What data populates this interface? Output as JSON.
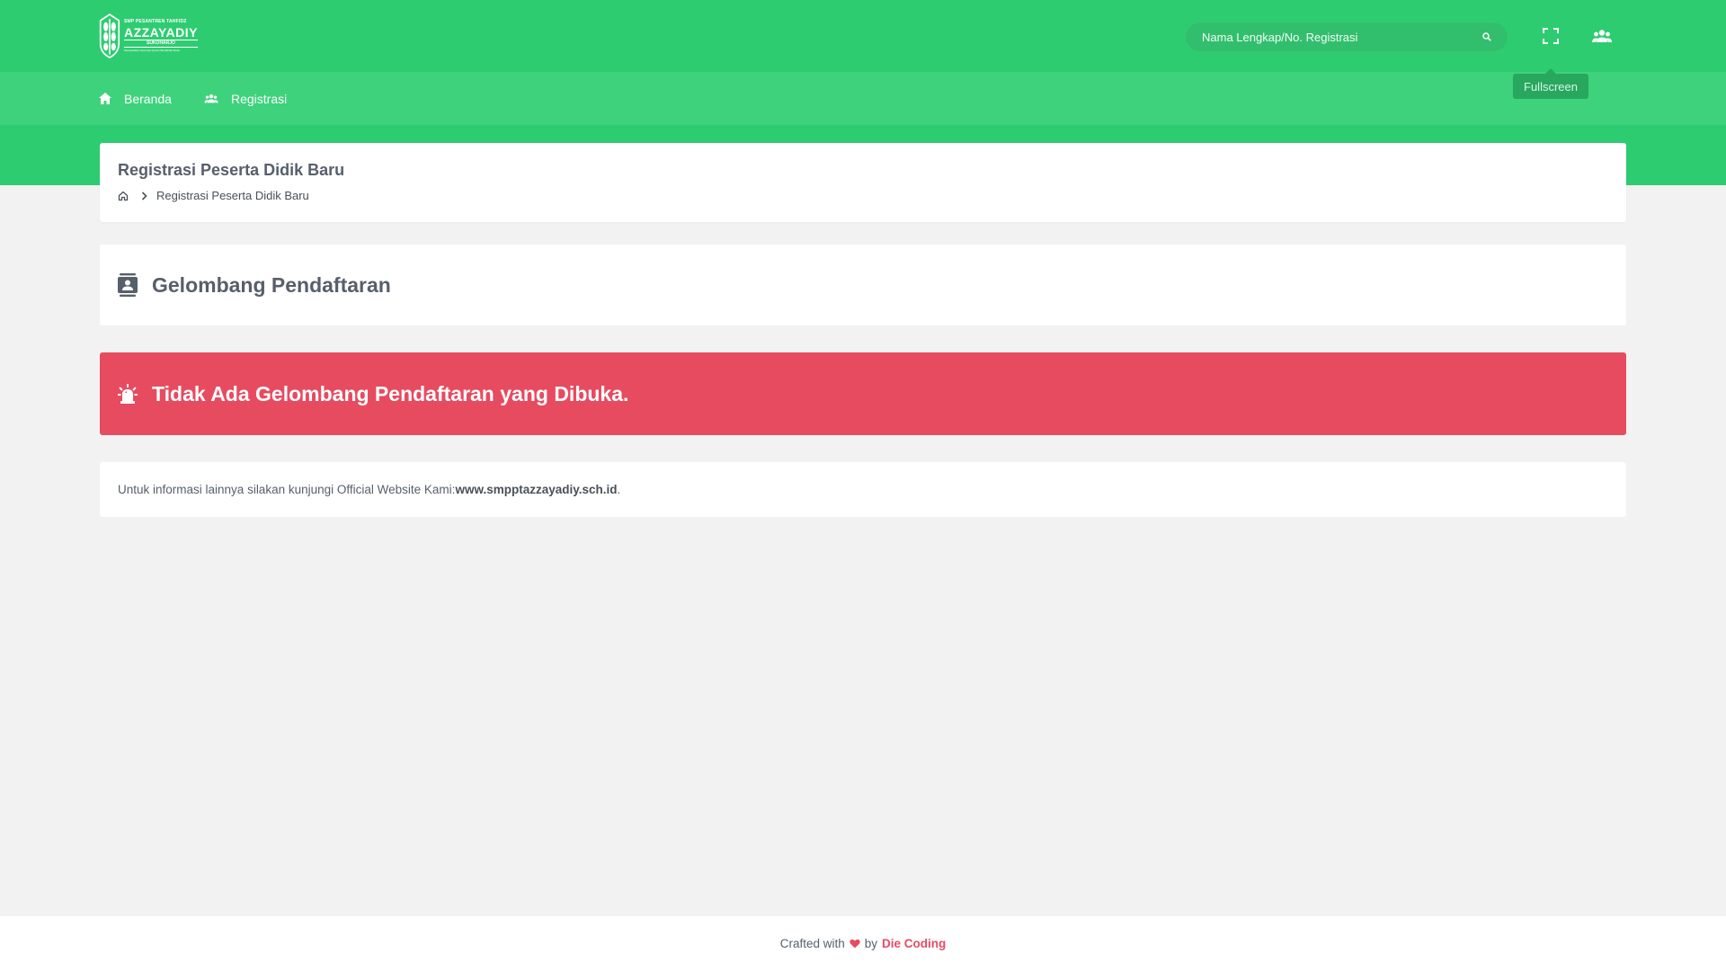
{
  "brand": {
    "line_small": "SMP PESANTREN TAHFIDZ",
    "line_main": "AZZAYADIY",
    "line_city": "SUKOHARJO",
    "tagline": "Mewujudkan Generasi Qurani Berakhlak Mulia"
  },
  "search": {
    "placeholder": "Nama Lengkap/No. Registrasi"
  },
  "header": {
    "tooltip": "Fullscreen"
  },
  "nav": {
    "home_label": "Beranda",
    "register_label": "Registrasi"
  },
  "page": {
    "title": "Registrasi Peserta Didik Baru",
    "breadcrumb_current": "Registrasi Peserta Didik Baru"
  },
  "wave": {
    "title": "Gelombang Pendaftaran"
  },
  "alert": {
    "message": "Tidak Ada Gelombang Pendaftaran yang Dibuka."
  },
  "info": {
    "text": "Untuk informasi lainnya silakan kunjungi Official Website Kami: ",
    "link": "www.smpptazzayadiy.sch.id",
    "suffix": "."
  },
  "footer": {
    "prefix": "Crafted with",
    "by": "by",
    "author": "Die Coding"
  },
  "colors": {
    "brand_green": "#2ecc71",
    "nav_green": "#3ed27c",
    "alert_red": "#e74b60",
    "background": "#f2f2f2"
  }
}
